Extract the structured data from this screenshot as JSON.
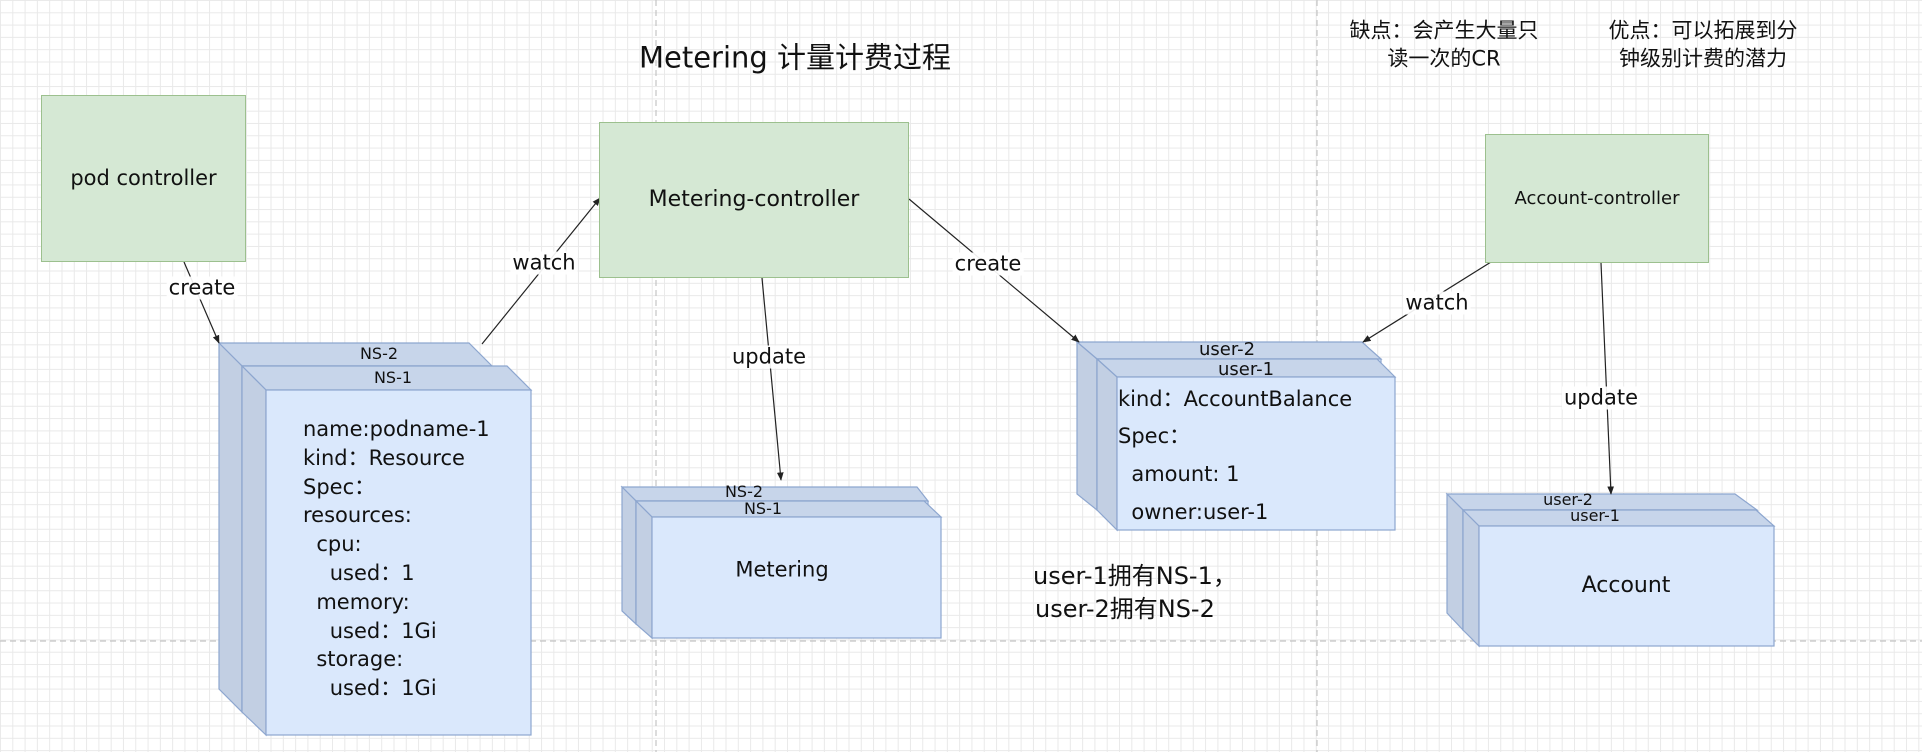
{
  "title": "Metering 计量计费过程",
  "notes": {
    "cons_line1": "缺点：会产生大量只",
    "cons_line2": "读一次的CR",
    "pros_line1": "优点：可以拓展到分",
    "pros_line2": "钟级别计费的潜力"
  },
  "controllers": {
    "pod": "pod controller",
    "metering": "Metering-controller",
    "account": "Account-controller"
  },
  "edges": {
    "pod_create": "create",
    "resource_watch": "watch",
    "metering_update": "update",
    "balance_create": "create",
    "account_watch": "watch",
    "account_update": "update"
  },
  "resource_stack": {
    "back_label": "NS-2",
    "front_label": "NS-1",
    "lines": [
      "name:podname-1",
      "kind：Resource",
      "Spec：",
      "resources:",
      "  cpu:",
      "    used：1",
      "  memory:",
      "    used：1Gi",
      "  storage:",
      "    used：1Gi"
    ]
  },
  "metering_stack": {
    "back_label": "NS-2",
    "front_label": "NS-1",
    "body": "Metering"
  },
  "balance_stack": {
    "back_label": "user-2",
    "front_label": "user-1",
    "lines": [
      "kind：AccountBalance",
      "Spec：",
      "  amount: 1",
      "  owner:user-1"
    ]
  },
  "account_stack": {
    "back_label": "user-2",
    "front_label": "user-1",
    "body": "Account"
  },
  "ownership": {
    "line1": "user-1拥有NS-1，",
    "line2": "user-2拥有NS-2"
  },
  "colors": {
    "controller_fill": "#d5e8d4",
    "controller_border": "#9cc08e",
    "cr_fill": "#dae8fc",
    "cr_border": "#8da6cf",
    "grid": "#e9e9e9",
    "divider": "#c4c4c4"
  }
}
